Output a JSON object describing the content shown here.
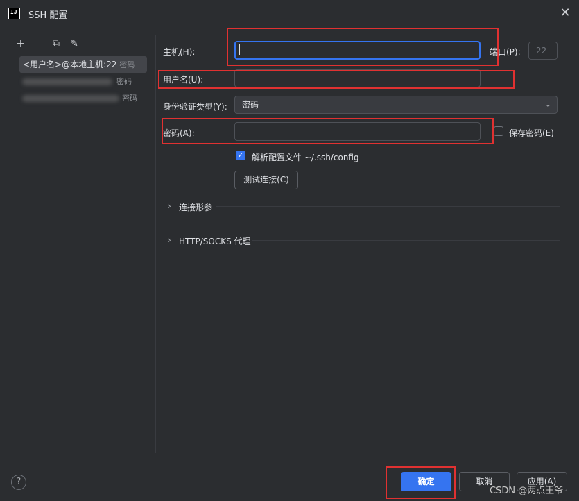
{
  "window": {
    "title": "SSH 配置",
    "app_icon_text": "IJ"
  },
  "toolbar": {
    "add": "+",
    "remove": "—",
    "copy": "⧉",
    "edit": "✎"
  },
  "list": {
    "items": [
      {
        "name": "<用户名>@本地主机:22",
        "auth": "密码"
      },
      {
        "name": "",
        "auth": "密码"
      },
      {
        "name": "",
        "auth": "密码"
      }
    ]
  },
  "form": {
    "host_label": "主机(H):",
    "host_value": "",
    "port_label": "端口(P):",
    "port_placeholder": "22",
    "username_label": "用户名(U):",
    "username_value": "",
    "auth_label": "身份验证类型(Y):",
    "auth_value": "密码",
    "password_label": "密码(A):",
    "password_value": "",
    "save_password_label": "保存密码(E)",
    "parse_config_label": "解析配置文件 ~/.ssh/config",
    "parse_config_checked": true,
    "test_button": "测试连接(C)",
    "section_connection": "连接形参",
    "section_proxy": "HTTP/SOCKS 代理"
  },
  "footer": {
    "help": "?",
    "ok": "确定",
    "cancel": "取消",
    "apply": "应用(A)"
  },
  "watermark": "CSDN @两点王爷",
  "colors": {
    "accent": "#3574f0",
    "annotation_red": "#e03131",
    "background": "#2b2d30"
  }
}
